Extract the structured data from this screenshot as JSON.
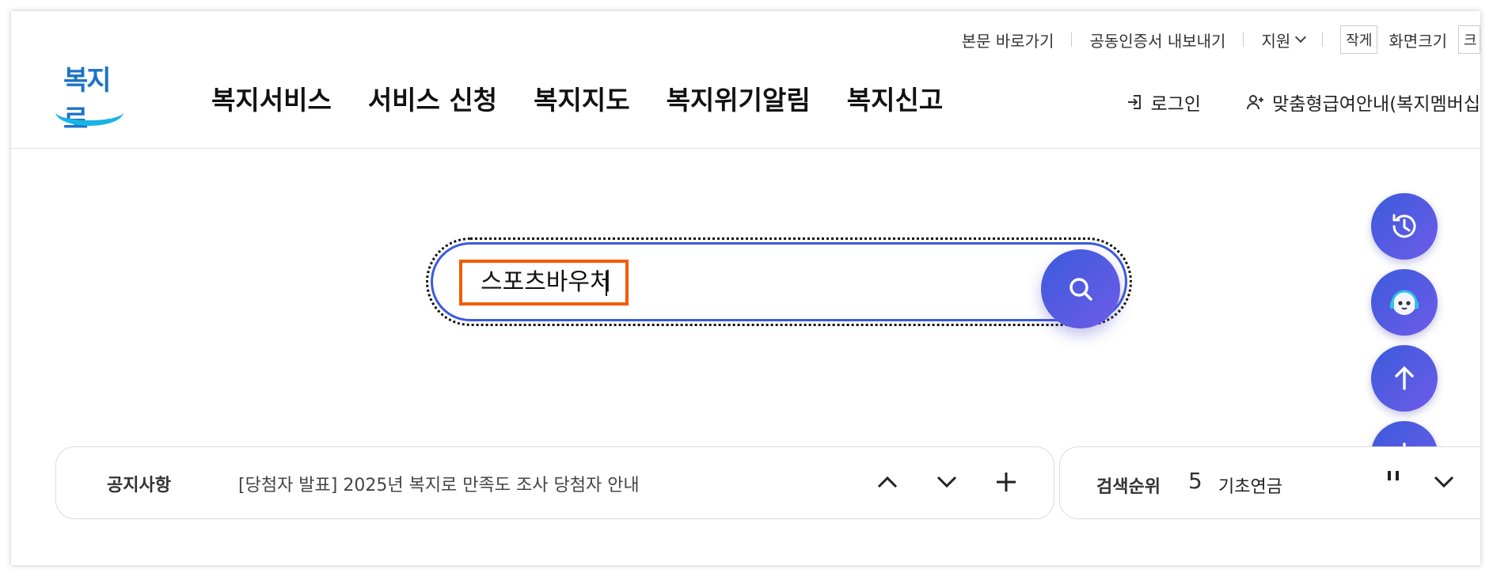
{
  "utility_bar": {
    "skip_to_content": "본문 바로가기",
    "export_cert": "공동인증서 내보내기",
    "support": "지원",
    "smaller": "작게",
    "font_size": "화면크기",
    "larger": "크"
  },
  "logo": {
    "text": "복지로"
  },
  "gnb": {
    "items": [
      "복지서비스",
      "서비스 신청",
      "복지지도",
      "복지위기알림",
      "복지신고"
    ]
  },
  "header_right": {
    "login": "로그인",
    "custom_benefit": "맞춤형급여안내(복지멤버십"
  },
  "search": {
    "value": "스포츠바우처",
    "button_icon": "search-icon"
  },
  "floating_buttons": [
    {
      "icon": "history-icon"
    },
    {
      "icon": "chatbot-icon"
    },
    {
      "icon": "arrow-up-icon"
    },
    {
      "icon": "arrow-down-icon"
    }
  ],
  "notice": {
    "label": "공지사항",
    "text": "[당첨자 발표] 2025년 복지로 만족도 조사 당첨자 안내"
  },
  "rank": {
    "label": "검색순위",
    "number": "5",
    "text": "기초연금"
  },
  "colors": {
    "accent_blue": "#3b5bdb",
    "accent_purple": "#6e5be8",
    "highlight_orange": "#f25c05",
    "logo_blue": "#1a73c8",
    "logo_cyan": "#19b4e6"
  }
}
